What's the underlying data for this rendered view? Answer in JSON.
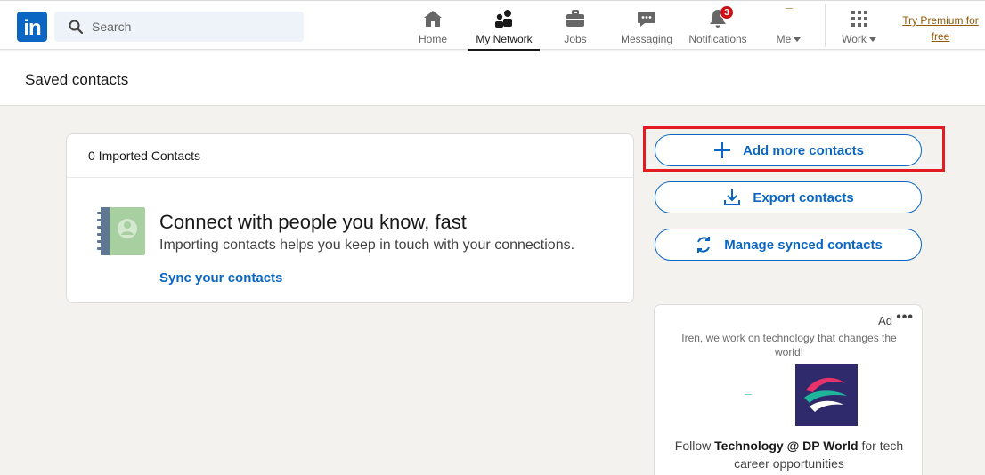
{
  "nav": {
    "logo_text": "in",
    "search_placeholder": "Search",
    "items": [
      {
        "label": "Home",
        "icon": "home-icon"
      },
      {
        "label": "My Network",
        "icon": "people-icon"
      },
      {
        "label": "Jobs",
        "icon": "briefcase-icon"
      },
      {
        "label": "Messaging",
        "icon": "chat-icon"
      },
      {
        "label": "Notifications",
        "icon": "bell-icon",
        "badge": "3"
      },
      {
        "label": "Me",
        "icon": "avatar-icon"
      },
      {
        "label": "Work",
        "icon": "grid-icon"
      }
    ],
    "premium_line1": "Try Premium for",
    "premium_line2": "free"
  },
  "page": {
    "title": "Saved contacts"
  },
  "card": {
    "header": "0 Imported Contacts",
    "headline": "Connect with people you know, fast",
    "subtext": "Importing contacts helps you keep in touch with your connections.",
    "sync_link": "Sync your contacts"
  },
  "actions": {
    "add": "Add more contacts",
    "export": "Export contacts",
    "manage": "Manage synced contacts"
  },
  "ad": {
    "label": "Ad",
    "message": "Iren, we work on technology that changes the world!",
    "follow_prefix": "Follow ",
    "follow_company": "Technology @ DP World",
    "follow_suffix": " for tech career opportunities"
  },
  "colors": {
    "brand": "#0a66c2",
    "highlight": "#e31c23",
    "premium": "#915907",
    "badge": "#cc1016"
  }
}
